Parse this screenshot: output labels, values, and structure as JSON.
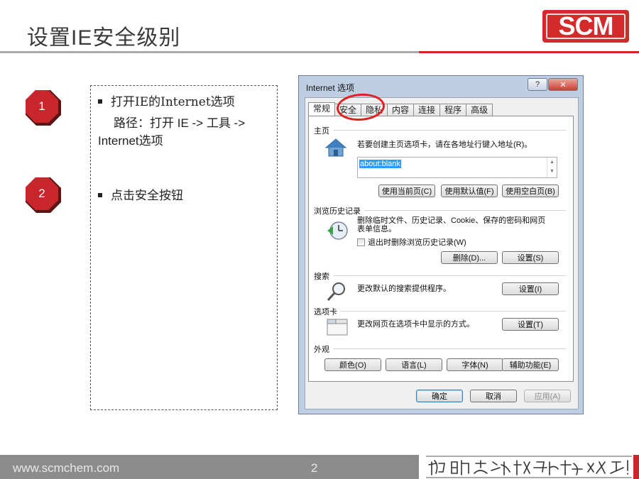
{
  "slide": {
    "title": "设置IE安全级别",
    "logo_text": "SCM",
    "footer_url": "www.scmchem.com",
    "page_number": "2",
    "slogan": "把明天的科技融入今天！",
    "accent_color": "#c8262b"
  },
  "steps": [
    {
      "number": "1",
      "text": "打开IE的Internet选项",
      "path_line1": "路径：打开 IE -> 工具 ->",
      "path_line2": "Internet选项"
    },
    {
      "number": "2",
      "text": "点击安全按钮"
    }
  ],
  "dialog": {
    "title": "Internet 选项",
    "help_label": "?",
    "close_label": "✕",
    "tabs": [
      "常规",
      "安全",
      "隐私",
      "内容",
      "连接",
      "程序",
      "高级"
    ],
    "active_tab": "常规",
    "highlighted_tab": "安全",
    "home": {
      "section": "主页",
      "description": "若要创建主页选项卡，请在各地址行键入地址(R)。",
      "url_value": "about:blank",
      "buttons": [
        "使用当前页(C)",
        "使用默认值(F)",
        "使用空白页(B)"
      ]
    },
    "history": {
      "section": "浏览历史记录",
      "description_line1": "删除临时文件、历史记录、Cookie、保存的密码和网页",
      "description_line2": "表单信息。",
      "checkbox_label": "退出时删除浏览历史记录(W)",
      "checkbox_checked": false,
      "delete_label": "删除(D)...",
      "settings_label": "设置(S)"
    },
    "search": {
      "section": "搜索",
      "description": "更改默认的搜索提供程序。",
      "settings_label": "设置(I)"
    },
    "tabs_section": {
      "section": "选项卡",
      "description": "更改网页在选项卡中显示的方式。",
      "settings_label": "设置(T)"
    },
    "appearance": {
      "section": "外观",
      "buttons": [
        "颜色(O)",
        "语言(L)",
        "字体(N)",
        "辅助功能(E)"
      ]
    },
    "footer_buttons": {
      "ok": "确定",
      "cancel": "取消",
      "apply": "应用(A)"
    }
  }
}
